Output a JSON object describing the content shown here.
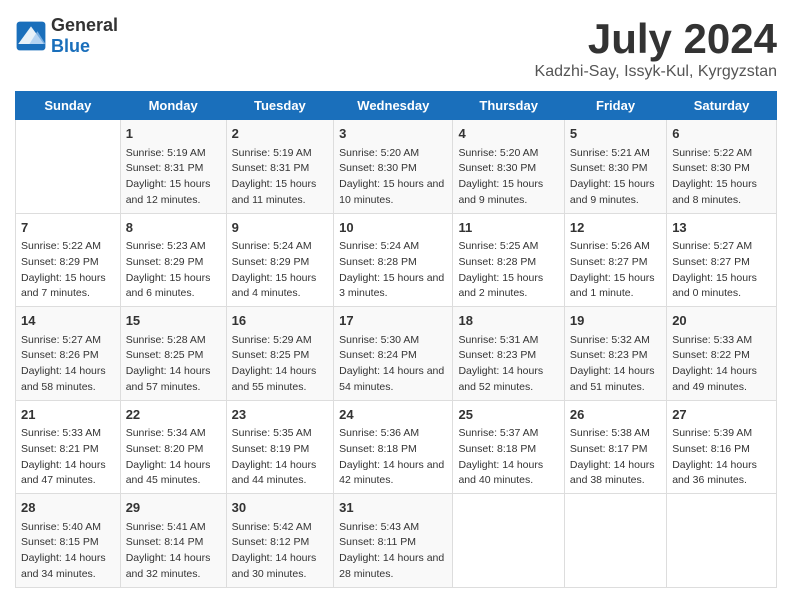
{
  "logo": {
    "general": "General",
    "blue": "Blue"
  },
  "title": {
    "month_year": "July 2024",
    "location": "Kadzhi-Say, Issyk-Kul, Kyrgyzstan"
  },
  "days_of_week": [
    "Sunday",
    "Monday",
    "Tuesday",
    "Wednesday",
    "Thursday",
    "Friday",
    "Saturday"
  ],
  "weeks": [
    [
      {
        "num": "",
        "info": ""
      },
      {
        "num": "1",
        "info": "Sunrise: 5:19 AM\nSunset: 8:31 PM\nDaylight: 15 hours and 12 minutes."
      },
      {
        "num": "2",
        "info": "Sunrise: 5:19 AM\nSunset: 8:31 PM\nDaylight: 15 hours and 11 minutes."
      },
      {
        "num": "3",
        "info": "Sunrise: 5:20 AM\nSunset: 8:30 PM\nDaylight: 15 hours and 10 minutes."
      },
      {
        "num": "4",
        "info": "Sunrise: 5:20 AM\nSunset: 8:30 PM\nDaylight: 15 hours and 9 minutes."
      },
      {
        "num": "5",
        "info": "Sunrise: 5:21 AM\nSunset: 8:30 PM\nDaylight: 15 hours and 9 minutes."
      },
      {
        "num": "6",
        "info": "Sunrise: 5:22 AM\nSunset: 8:30 PM\nDaylight: 15 hours and 8 minutes."
      }
    ],
    [
      {
        "num": "7",
        "info": "Sunrise: 5:22 AM\nSunset: 8:29 PM\nDaylight: 15 hours and 7 minutes."
      },
      {
        "num": "8",
        "info": "Sunrise: 5:23 AM\nSunset: 8:29 PM\nDaylight: 15 hours and 6 minutes."
      },
      {
        "num": "9",
        "info": "Sunrise: 5:24 AM\nSunset: 8:29 PM\nDaylight: 15 hours and 4 minutes."
      },
      {
        "num": "10",
        "info": "Sunrise: 5:24 AM\nSunset: 8:28 PM\nDaylight: 15 hours and 3 minutes."
      },
      {
        "num": "11",
        "info": "Sunrise: 5:25 AM\nSunset: 8:28 PM\nDaylight: 15 hours and 2 minutes."
      },
      {
        "num": "12",
        "info": "Sunrise: 5:26 AM\nSunset: 8:27 PM\nDaylight: 15 hours and 1 minute."
      },
      {
        "num": "13",
        "info": "Sunrise: 5:27 AM\nSunset: 8:27 PM\nDaylight: 15 hours and 0 minutes."
      }
    ],
    [
      {
        "num": "14",
        "info": "Sunrise: 5:27 AM\nSunset: 8:26 PM\nDaylight: 14 hours and 58 minutes."
      },
      {
        "num": "15",
        "info": "Sunrise: 5:28 AM\nSunset: 8:25 PM\nDaylight: 14 hours and 57 minutes."
      },
      {
        "num": "16",
        "info": "Sunrise: 5:29 AM\nSunset: 8:25 PM\nDaylight: 14 hours and 55 minutes."
      },
      {
        "num": "17",
        "info": "Sunrise: 5:30 AM\nSunset: 8:24 PM\nDaylight: 14 hours and 54 minutes."
      },
      {
        "num": "18",
        "info": "Sunrise: 5:31 AM\nSunset: 8:23 PM\nDaylight: 14 hours and 52 minutes."
      },
      {
        "num": "19",
        "info": "Sunrise: 5:32 AM\nSunset: 8:23 PM\nDaylight: 14 hours and 51 minutes."
      },
      {
        "num": "20",
        "info": "Sunrise: 5:33 AM\nSunset: 8:22 PM\nDaylight: 14 hours and 49 minutes."
      }
    ],
    [
      {
        "num": "21",
        "info": "Sunrise: 5:33 AM\nSunset: 8:21 PM\nDaylight: 14 hours and 47 minutes."
      },
      {
        "num": "22",
        "info": "Sunrise: 5:34 AM\nSunset: 8:20 PM\nDaylight: 14 hours and 45 minutes."
      },
      {
        "num": "23",
        "info": "Sunrise: 5:35 AM\nSunset: 8:19 PM\nDaylight: 14 hours and 44 minutes."
      },
      {
        "num": "24",
        "info": "Sunrise: 5:36 AM\nSunset: 8:18 PM\nDaylight: 14 hours and 42 minutes."
      },
      {
        "num": "25",
        "info": "Sunrise: 5:37 AM\nSunset: 8:18 PM\nDaylight: 14 hours and 40 minutes."
      },
      {
        "num": "26",
        "info": "Sunrise: 5:38 AM\nSunset: 8:17 PM\nDaylight: 14 hours and 38 minutes."
      },
      {
        "num": "27",
        "info": "Sunrise: 5:39 AM\nSunset: 8:16 PM\nDaylight: 14 hours and 36 minutes."
      }
    ],
    [
      {
        "num": "28",
        "info": "Sunrise: 5:40 AM\nSunset: 8:15 PM\nDaylight: 14 hours and 34 minutes."
      },
      {
        "num": "29",
        "info": "Sunrise: 5:41 AM\nSunset: 8:14 PM\nDaylight: 14 hours and 32 minutes."
      },
      {
        "num": "30",
        "info": "Sunrise: 5:42 AM\nSunset: 8:12 PM\nDaylight: 14 hours and 30 minutes."
      },
      {
        "num": "31",
        "info": "Sunrise: 5:43 AM\nSunset: 8:11 PM\nDaylight: 14 hours and 28 minutes."
      },
      {
        "num": "",
        "info": ""
      },
      {
        "num": "",
        "info": ""
      },
      {
        "num": "",
        "info": ""
      }
    ]
  ]
}
